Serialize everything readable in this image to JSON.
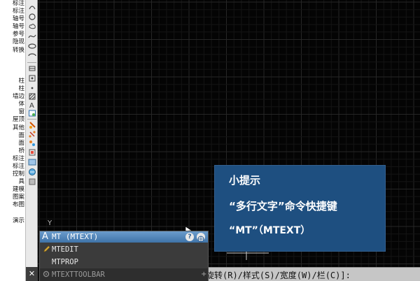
{
  "left_palette": {
    "items": [
      "标注",
      "标注",
      "轴号",
      "轴号",
      "参号",
      "隐现",
      "转换",
      "",
      "",
      "",
      "柱",
      "柱",
      "墙边",
      "体",
      "窗",
      "屋顶",
      "其他",
      "面",
      "面",
      "桥",
      "标注",
      "标注",
      "控制",
      "具",
      "建模",
      "图案",
      "布图",
      "",
      "演示"
    ]
  },
  "tip": {
    "title": "小提示",
    "line1": "“多行文字”命令快捷键",
    "line2": "“MT”（MTEXT）"
  },
  "autocomplete": {
    "header": "MT (MTEXT)",
    "items": [
      "MTEDIT",
      "MTPROP",
      "MTEXTTOOLBAR"
    ]
  },
  "command_line": {
    "text": "旋转(R)/样式(S)/宽度(W)/栏(C)]:"
  },
  "ucs_label": "Y",
  "colors": {
    "tip_bg": "#1e4f80",
    "popup_header": "#4f86bb",
    "canvas": "#040404"
  }
}
